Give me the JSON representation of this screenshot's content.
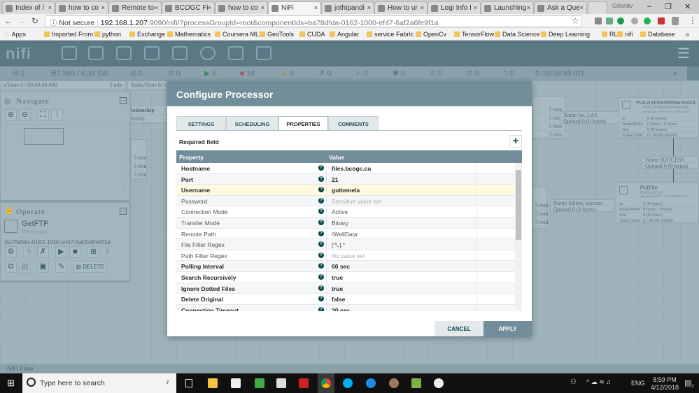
{
  "browser": {
    "tabs": [
      {
        "label": "Index of /"
      },
      {
        "label": "how to co"
      },
      {
        "label": "Remote to"
      },
      {
        "label": "BCOGC Fi"
      },
      {
        "label": "how to co"
      },
      {
        "label": "NiFi",
        "active": true
      },
      {
        "label": "jothipandi"
      },
      {
        "label": "How to ur"
      },
      {
        "label": "Logi Info I"
      },
      {
        "label": "Launching"
      },
      {
        "label": "Ask a Que"
      }
    ],
    "profile": "Gourav",
    "security": "Not secure",
    "url_host": "192.168.1.207",
    "url_rest": ":9090/nifi/?processGroupId=root&componentIds=ba78dfda-0162-1000-ef47-6af2a6fe9f1a",
    "bookmarks": [
      "Apps",
      "Imported From IE",
      "python",
      "Exchange",
      "Mathematics",
      "Coursera ML",
      "GeoTools",
      "CUDA",
      "Angular",
      "service Fabric",
      "OpenCv",
      "TensorFlow",
      "Data Science",
      "Deep Learning",
      "RL",
      "nifi",
      "Database"
    ],
    "more_bookmarks": "»"
  },
  "nifi": {
    "status": {
      "nodes": "1",
      "queued": "2,549 / 6.39 GB",
      "transmitting": "0",
      "not_transmitting": "0",
      "running": "5",
      "stopped": "16",
      "invalid": "3",
      "disabled": "0",
      "up_to_date": "0",
      "locally_modified": "0",
      "stale": "0",
      "modified_stale": "0",
      "sync_failure": "0",
      "refreshed": "20:58:49 IST"
    },
    "navigate": {
      "title": "Navigate"
    },
    "operate": {
      "title": "Operate",
      "component_name": "GetFTP",
      "component_type": "Processor",
      "component_id": "ba78dfda-0162-1000-ef47-6af2a6fe9f1a",
      "delete_label": "DELETE"
    },
    "canvas": {
      "top_left": "s/Time  0 / 00:00:00.000",
      "top_left_time": "5 min",
      "top_mid": "Tasks/Time  0 / 00:0",
      "relationship": "lationship",
      "rel_bytes": "bytes)",
      "min_labels": [
        "5 min",
        "5 min",
        "5 min",
        "5 min"
      ],
      "conn1": {
        "name": "Name  las, LAS",
        "queued": "Queued  0 (0 bytes)"
      },
      "proc1": {
        "name": "PutLASFileWellNameADL",
        "type": "PutLASFileWellNameADL",
        "bundle": "nifi-put_las_wellName_A_DL-processors",
        "in": "0 (0 bytes)",
        "rw": "0 bytes / 0 bytes",
        "out": "0 (0 bytes)",
        "tasks": "0 / 00:00:00.000"
      },
      "conn2": {
        "name": "Name  SUCCESS",
        "queued": "Queued  0 (0 bytes)"
      },
      "conn3": {
        "name": "Name  failure, success",
        "queued": "Queued  0 (0 bytes)"
      },
      "proc2": {
        "name": "PutFile",
        "type": "PutFile 1.5.0",
        "bundle": "org.apache.nifi - nifi-standard-nar",
        "in": "0 (0 bytes)",
        "rw": "0 bytes / 0 bytes",
        "out": "0 (0 bytes)",
        "tasks": "0 / 00:00:00.000"
      },
      "labels": {
        "in": "In",
        "rw": "Read/Write",
        "out": "Out",
        "tasks": "Tasks/Time"
      }
    },
    "footer": "NiFi Flow"
  },
  "dialog": {
    "title": "Configure Processor",
    "tabs": [
      "SETTINGS",
      "SCHEDULING",
      "PROPERTIES",
      "COMMENTS"
    ],
    "active_tab": "PROPERTIES",
    "required_field": "Required field",
    "add_icon": "+",
    "columns": [
      "Property",
      "Value"
    ],
    "properties": [
      {
        "name": "Hostname",
        "value": "files.bcogc.ca",
        "required": true
      },
      {
        "name": "Port",
        "value": "21",
        "required": true
      },
      {
        "name": "Username",
        "value": "guttemela",
        "required": true,
        "selected": true
      },
      {
        "name": "Password",
        "value": "Sensitive value set",
        "required": false
      },
      {
        "name": "Connection Mode",
        "value": "Active",
        "required": false
      },
      {
        "name": "Transfer Mode",
        "value": "Binary",
        "required": false
      },
      {
        "name": "Remote Path",
        "value": "/WellData",
        "required": false
      },
      {
        "name": "File Filter Regex",
        "value": "[^\\.].*",
        "required": false
      },
      {
        "name": "Path Filter Regex",
        "value": "No value set",
        "required": false
      },
      {
        "name": "Polling Interval",
        "value": "60 sec",
        "required": true
      },
      {
        "name": "Search Recursively",
        "value": "true",
        "required": true
      },
      {
        "name": "Ignore Dotted Files",
        "value": "true",
        "required": true
      },
      {
        "name": "Delete Original",
        "value": "false",
        "required": true
      },
      {
        "name": "Connection Timeout",
        "value": "30 sec",
        "required": true
      }
    ],
    "cancel": "CANCEL",
    "apply": "APPLY",
    "accent": "#728e9b"
  },
  "taskbar": {
    "search_placeholder": "Type here to search",
    "time": "8:59 PM",
    "date": "4/12/2018",
    "lang": "ENG",
    "notifications": "2"
  }
}
